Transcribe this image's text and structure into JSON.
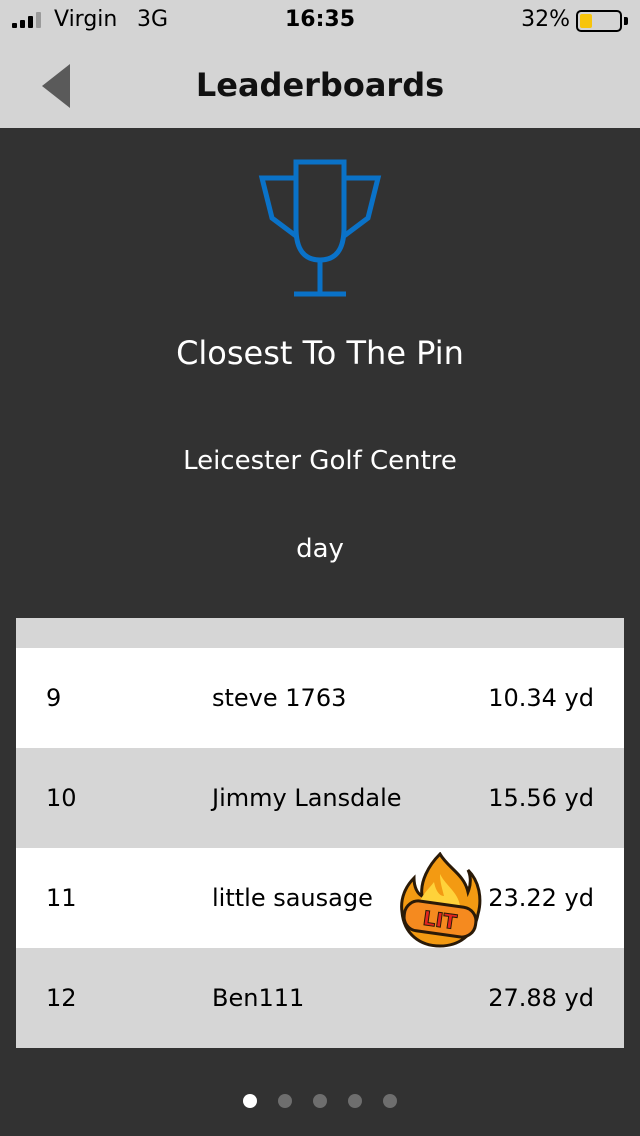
{
  "status_bar": {
    "carrier": "Virgin",
    "network": "3G",
    "time": "16:35",
    "battery_percent": "32%",
    "battery_level": 0.32,
    "signal_bars": 3,
    "signal_bars_total": 4
  },
  "nav": {
    "title": "Leaderboards",
    "back_icon": "back-arrow-icon"
  },
  "header": {
    "icon": "trophy-icon",
    "accent_color": "#0a72c8",
    "title": "Closest To The Pin",
    "venue": "Leicester Golf Centre",
    "period": "day"
  },
  "leaderboard": {
    "rows": [
      {
        "rank": "9",
        "name": "steve 1763",
        "distance": "10.34 yd"
      },
      {
        "rank": "10",
        "name": "Jimmy Lansdale",
        "distance": "15.56 yd"
      },
      {
        "rank": "11",
        "name": "little sausage",
        "distance": "23.22 yd",
        "sticker": "LIT"
      },
      {
        "rank": "12",
        "name": "Ben111",
        "distance": "27.88 yd"
      }
    ]
  },
  "pagination": {
    "total": 5,
    "active_index": 0
  }
}
